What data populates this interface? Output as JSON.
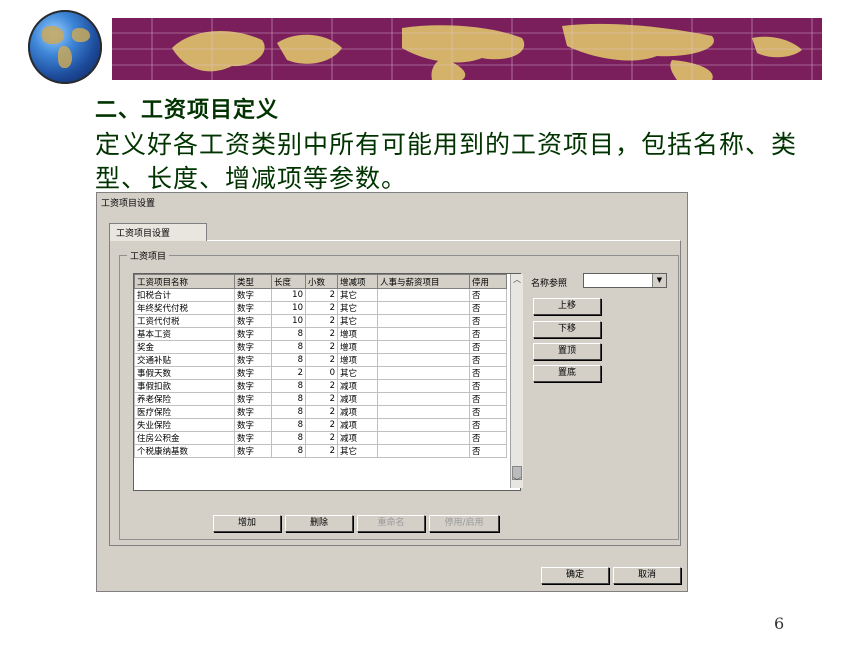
{
  "slide": {
    "heading": "二、工资项目定义",
    "description": "定义好各工资类别中所有可能用到的工资项目，包括名称、类型、长度、增减项等参数。",
    "page_number": "6"
  },
  "dialog": {
    "title": "工资项目设置",
    "tab_label": "工资项目设置",
    "group_title": "工资项目",
    "columns": [
      "工资项目名称",
      "类型",
      "长度",
      "小数",
      "增减项",
      "人事与薪资项目",
      "停用"
    ],
    "rows": [
      [
        "扣税合计",
        "数字",
        "10",
        "2",
        "其它",
        "",
        "否"
      ],
      [
        "年终奖代付税",
        "数字",
        "10",
        "2",
        "其它",
        "",
        "否"
      ],
      [
        "工资代付税",
        "数字",
        "10",
        "2",
        "其它",
        "",
        "否"
      ],
      [
        "基本工资",
        "数字",
        "8",
        "2",
        "增项",
        "",
        "否"
      ],
      [
        "奖金",
        "数字",
        "8",
        "2",
        "增项",
        "",
        "否"
      ],
      [
        "交通补贴",
        "数字",
        "8",
        "2",
        "增项",
        "",
        "否"
      ],
      [
        "事假天数",
        "数字",
        "2",
        "0",
        "其它",
        "",
        "否"
      ],
      [
        "事假扣款",
        "数字",
        "8",
        "2",
        "减项",
        "",
        "否"
      ],
      [
        "养老保险",
        "数字",
        "8",
        "2",
        "减项",
        "",
        "否"
      ],
      [
        "医疗保险",
        "数字",
        "8",
        "2",
        "减项",
        "",
        "否"
      ],
      [
        "失业保险",
        "数字",
        "8",
        "2",
        "减项",
        "",
        "否"
      ],
      [
        "住房公积金",
        "数字",
        "8",
        "2",
        "减项",
        "",
        "否"
      ],
      [
        "个税康纳基数",
        "数字",
        "8",
        "2",
        "其它",
        "",
        "否"
      ]
    ],
    "name_reference_label": "名称参照",
    "name_reference_value": "",
    "side_buttons": {
      "move_up": "上移",
      "move_down": "下移",
      "set_top": "置顶",
      "set_bottom": "置底"
    },
    "bottom_buttons": {
      "add": "增加",
      "delete": "删除",
      "rename": "重命名",
      "disable_enable": "停用/启用"
    },
    "footer_buttons": {
      "ok": "确定",
      "cancel": "取消"
    }
  },
  "colors": {
    "banner": "#7a1f5c",
    "map_land": "#d4b26a",
    "heading_text": "#003300",
    "dialog_bg": "#d4d0c8"
  }
}
